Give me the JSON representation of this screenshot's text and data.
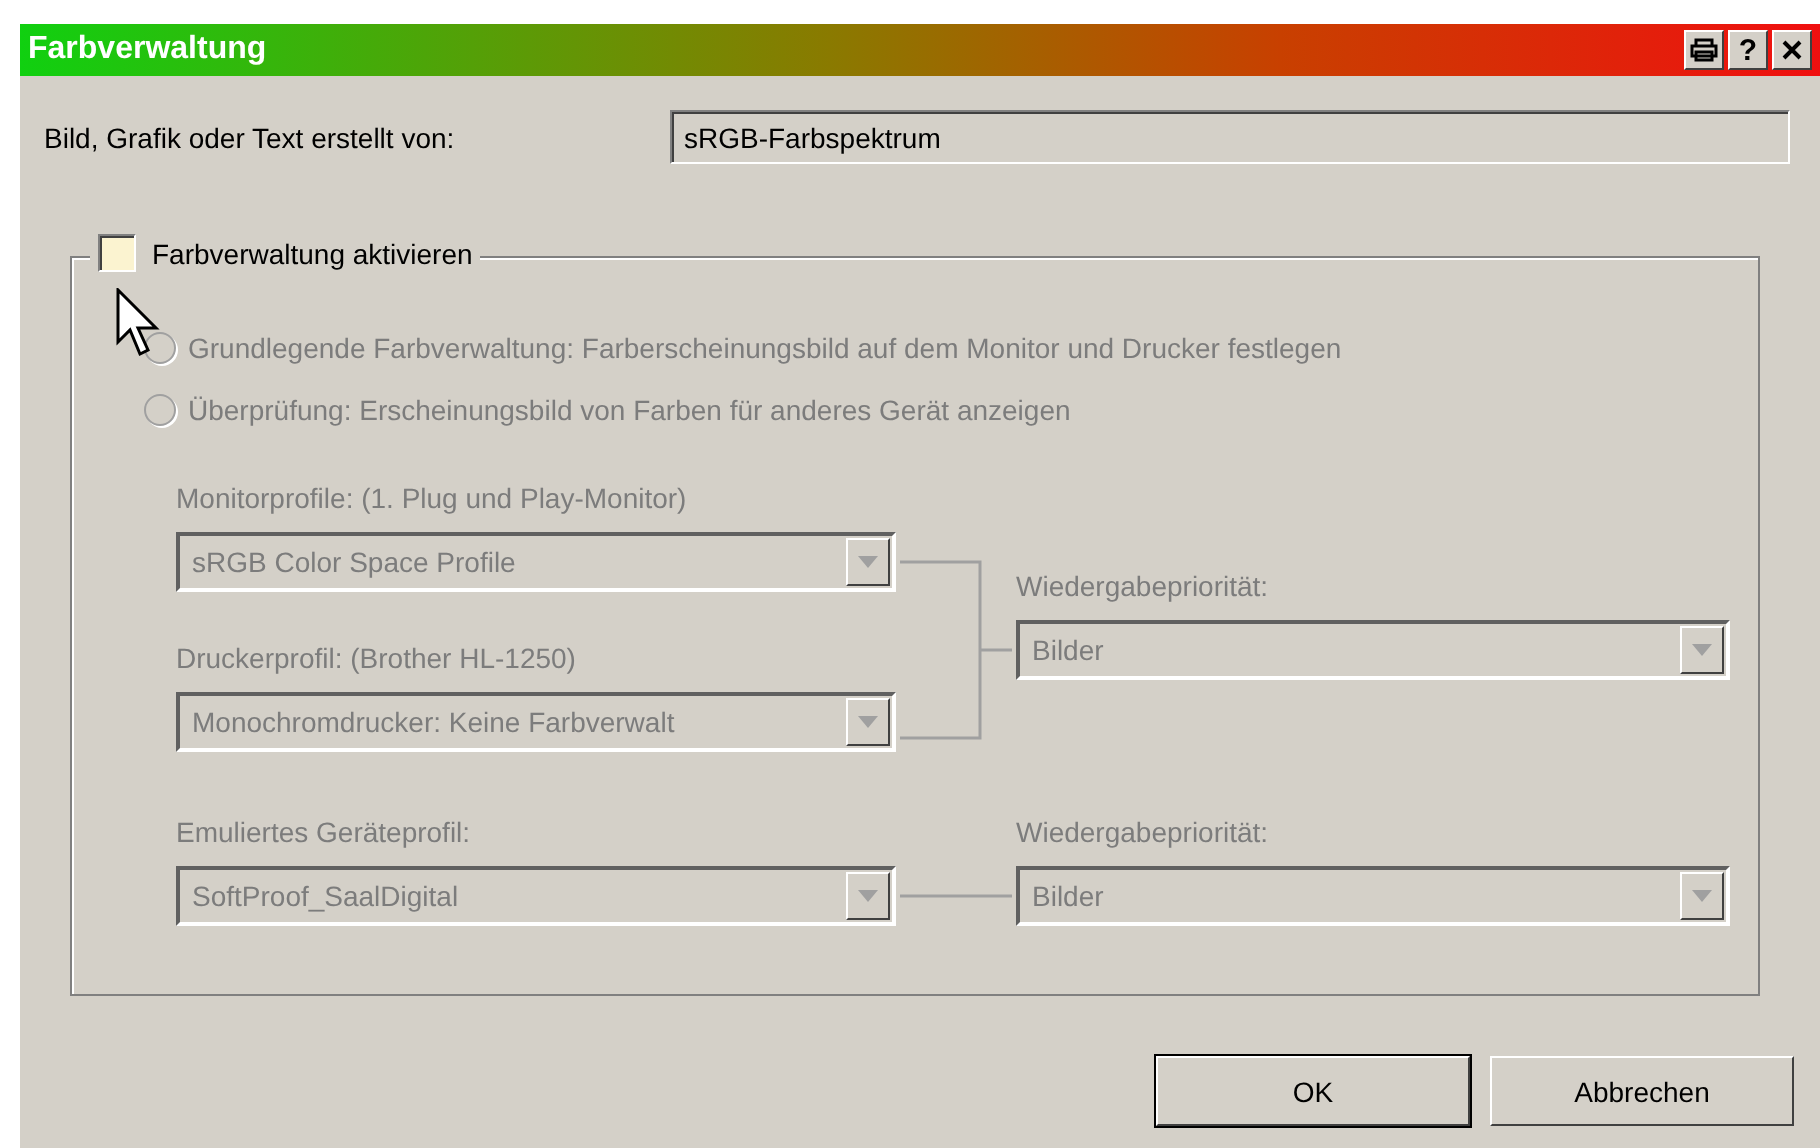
{
  "window": {
    "title": "Farbverwaltung",
    "title_buttons": [
      {
        "kind": "printer"
      },
      {
        "kind": "help",
        "label": "?"
      },
      {
        "kind": "close"
      }
    ]
  },
  "source": {
    "label": "Bild, Grafik oder Text erstellt von:",
    "value": "sRGB-Farbspektrum"
  },
  "color_management": {
    "label": "Farbverwaltung aktivieren",
    "checked": false,
    "disabled": true,
    "options": [
      {
        "label": "Grundlegende Farbverwaltung: Farberscheinungsbild auf dem Monitor und Drucker festlegen",
        "selected": false
      },
      {
        "label": "Überprüfung: Erscheinungsbild von Farben für anderes Gerät anzeigen",
        "selected": false
      }
    ],
    "monitor_profile": {
      "label": "Monitorprofile: (1. Plug und Play-Monitor)",
      "value": "sRGB Color Space Profile"
    },
    "printer_profile": {
      "label": "Druckerprofil: (Brother HL-1250)",
      "value": "Monochromdrucker: Keine Farbverwalt"
    },
    "rendering_intent": {
      "label": "Wiedergabepriorität:",
      "value": "Bilder"
    },
    "emulated_profile": {
      "label": "Emuliertes Geräteprofil:",
      "value": "SoftProof_SaalDigital"
    },
    "proof_rendering_intent": {
      "label": "Wiedergabepriorität:",
      "value": "Bilder"
    }
  },
  "buttons": [
    {
      "label": "OK",
      "default": true
    },
    {
      "label": "Abbrechen",
      "default": false
    }
  ]
}
